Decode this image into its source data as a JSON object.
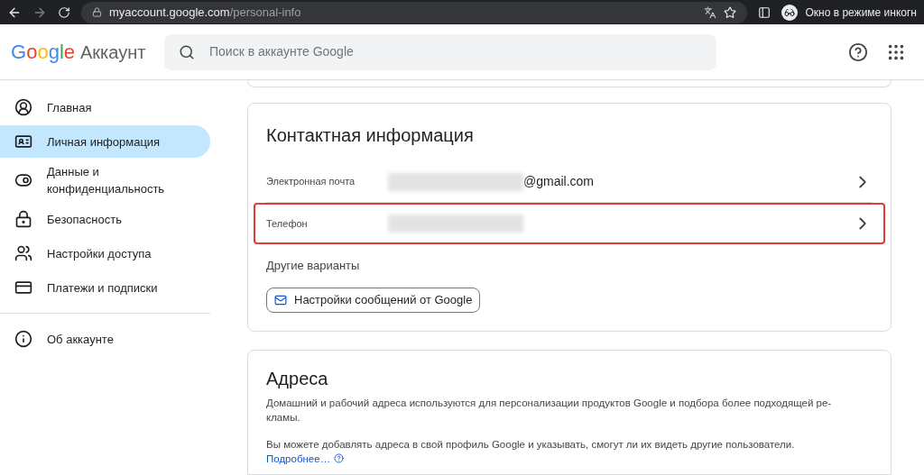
{
  "browser": {
    "url_host": "myaccount.google.com",
    "url_path": "/personal-info",
    "profile_label": "Окно в режиме инкогн"
  },
  "header": {
    "logo": "Google",
    "product": "Аккаунт",
    "search": {
      "placeholder": "Поиск в аккаунте Google"
    }
  },
  "sidebar": {
    "items": [
      {
        "kind": "home",
        "label": "Главная",
        "selected": false
      },
      {
        "kind": "personal",
        "label": "Личная информация",
        "selected": true
      },
      {
        "kind": "data",
        "label": "Данные и конфиденциальность",
        "selected": false
      },
      {
        "kind": "security",
        "label": "Безопасность",
        "selected": false
      },
      {
        "kind": "sharing",
        "label": "Настройки доступа",
        "selected": false
      },
      {
        "kind": "payments",
        "label": "Платежи и подписки",
        "selected": false
      }
    ],
    "footer_items": [
      {
        "kind": "about",
        "label": "Об аккаунте",
        "selected": false
      }
    ]
  },
  "contact_card": {
    "title": "Контактная информация",
    "rows": [
      {
        "label": "Электронная почта",
        "value_suffix": "@gmail.com",
        "highlighted": false
      },
      {
        "label": "Телефон",
        "highlighted": true
      }
    ],
    "other_label": "Другие варианты",
    "button": "Настройки сообщений от Google"
  },
  "address_card": {
    "title": "Адреса",
    "paragraphs": [
      "Домашний и рабочий адреса используются для персонализации продуктов Google и подбора более подходящей ре-\nкламы.",
      "Вы можете добавлять адреса в свой профиль Google и указывать, смогут ли их видеть другие пользователи."
    ],
    "link": "Подробнее…"
  }
}
